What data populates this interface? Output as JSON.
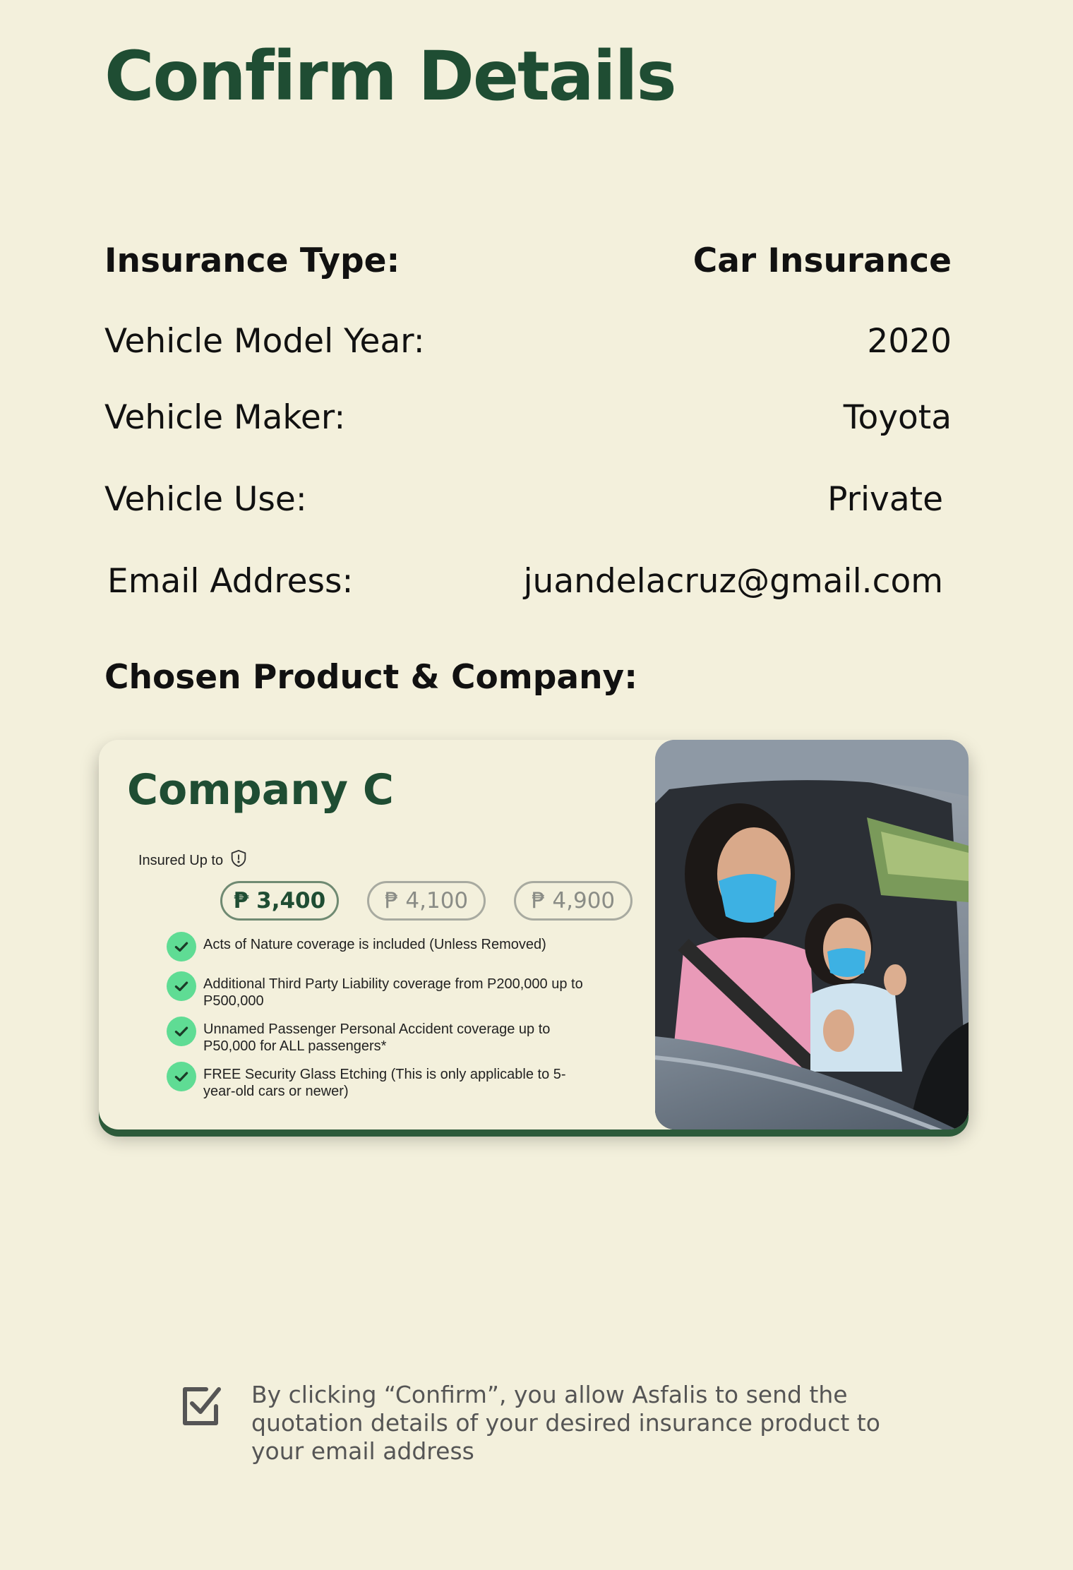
{
  "page": {
    "title": "Confirm Details"
  },
  "details": {
    "insurance_type_label": "Insurance Type:",
    "insurance_type_value": "Car Insurance",
    "model_year_label": "Vehicle Model Year:",
    "model_year_value": "2020",
    "maker_label": "Vehicle Maker:",
    "maker_value": "Toyota",
    "use_label": "Vehicle Use:",
    "use_value": "Private",
    "email_label": "Email Address:",
    "email_value": "juandelacruz@gmail.com"
  },
  "chosen_heading": "Chosen Product & Company:",
  "product": {
    "company": "Company C",
    "insured_label": "Insured Up to",
    "prices": [
      "₱ 3,400",
      "₱ 4,100",
      "₱ 4,900"
    ],
    "selected_price_index": 0,
    "features": [
      "Acts of Nature coverage is included (Unless Removed)",
      "Additional Third Party Liability coverage from P200,000 up to P500,000",
      "Unnamed Passenger Personal Accident coverage up to P50,000 for ALL passengers*",
      "FREE Security Glass Etching (This is only applicable to 5-year-old cars or newer)"
    ]
  },
  "consent": {
    "checked": true,
    "text": "By clicking “Confirm”, you allow Asfalis to send the quotation details of your desired insurance product to your email address"
  },
  "colors": {
    "background": "#f3f0dc",
    "brand_green": "#1f4d33",
    "check_green": "#5fdc94"
  }
}
